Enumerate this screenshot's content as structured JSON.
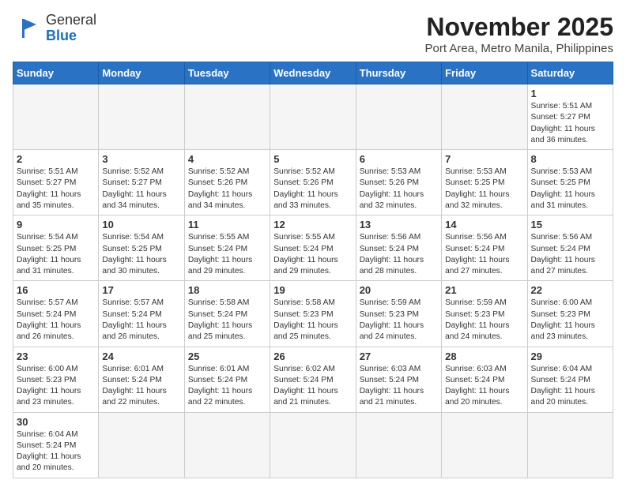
{
  "header": {
    "logo_general": "General",
    "logo_blue": "Blue",
    "month_title": "November 2025",
    "subtitle": "Port Area, Metro Manila, Philippines"
  },
  "weekdays": [
    "Sunday",
    "Monday",
    "Tuesday",
    "Wednesday",
    "Thursday",
    "Friday",
    "Saturday"
  ],
  "days": {
    "1": {
      "sunrise": "5:51 AM",
      "sunset": "5:27 PM",
      "daylight": "11 hours and 36 minutes."
    },
    "2": {
      "sunrise": "5:51 AM",
      "sunset": "5:27 PM",
      "daylight": "11 hours and 35 minutes."
    },
    "3": {
      "sunrise": "5:52 AM",
      "sunset": "5:27 PM",
      "daylight": "11 hours and 34 minutes."
    },
    "4": {
      "sunrise": "5:52 AM",
      "sunset": "5:26 PM",
      "daylight": "11 hours and 34 minutes."
    },
    "5": {
      "sunrise": "5:52 AM",
      "sunset": "5:26 PM",
      "daylight": "11 hours and 33 minutes."
    },
    "6": {
      "sunrise": "5:53 AM",
      "sunset": "5:26 PM",
      "daylight": "11 hours and 32 minutes."
    },
    "7": {
      "sunrise": "5:53 AM",
      "sunset": "5:25 PM",
      "daylight": "11 hours and 32 minutes."
    },
    "8": {
      "sunrise": "5:53 AM",
      "sunset": "5:25 PM",
      "daylight": "11 hours and 31 minutes."
    },
    "9": {
      "sunrise": "5:54 AM",
      "sunset": "5:25 PM",
      "daylight": "11 hours and 31 minutes."
    },
    "10": {
      "sunrise": "5:54 AM",
      "sunset": "5:25 PM",
      "daylight": "11 hours and 30 minutes."
    },
    "11": {
      "sunrise": "5:55 AM",
      "sunset": "5:24 PM",
      "daylight": "11 hours and 29 minutes."
    },
    "12": {
      "sunrise": "5:55 AM",
      "sunset": "5:24 PM",
      "daylight": "11 hours and 29 minutes."
    },
    "13": {
      "sunrise": "5:56 AM",
      "sunset": "5:24 PM",
      "daylight": "11 hours and 28 minutes."
    },
    "14": {
      "sunrise": "5:56 AM",
      "sunset": "5:24 PM",
      "daylight": "11 hours and 27 minutes."
    },
    "15": {
      "sunrise": "5:56 AM",
      "sunset": "5:24 PM",
      "daylight": "11 hours and 27 minutes."
    },
    "16": {
      "sunrise": "5:57 AM",
      "sunset": "5:24 PM",
      "daylight": "11 hours and 26 minutes."
    },
    "17": {
      "sunrise": "5:57 AM",
      "sunset": "5:24 PM",
      "daylight": "11 hours and 26 minutes."
    },
    "18": {
      "sunrise": "5:58 AM",
      "sunset": "5:24 PM",
      "daylight": "11 hours and 25 minutes."
    },
    "19": {
      "sunrise": "5:58 AM",
      "sunset": "5:23 PM",
      "daylight": "11 hours and 25 minutes."
    },
    "20": {
      "sunrise": "5:59 AM",
      "sunset": "5:23 PM",
      "daylight": "11 hours and 24 minutes."
    },
    "21": {
      "sunrise": "5:59 AM",
      "sunset": "5:23 PM",
      "daylight": "11 hours and 24 minutes."
    },
    "22": {
      "sunrise": "6:00 AM",
      "sunset": "5:23 PM",
      "daylight": "11 hours and 23 minutes."
    },
    "23": {
      "sunrise": "6:00 AM",
      "sunset": "5:23 PM",
      "daylight": "11 hours and 23 minutes."
    },
    "24": {
      "sunrise": "6:01 AM",
      "sunset": "5:24 PM",
      "daylight": "11 hours and 22 minutes."
    },
    "25": {
      "sunrise": "6:01 AM",
      "sunset": "5:24 PM",
      "daylight": "11 hours and 22 minutes."
    },
    "26": {
      "sunrise": "6:02 AM",
      "sunset": "5:24 PM",
      "daylight": "11 hours and 21 minutes."
    },
    "27": {
      "sunrise": "6:03 AM",
      "sunset": "5:24 PM",
      "daylight": "11 hours and 21 minutes."
    },
    "28": {
      "sunrise": "6:03 AM",
      "sunset": "5:24 PM",
      "daylight": "11 hours and 20 minutes."
    },
    "29": {
      "sunrise": "6:04 AM",
      "sunset": "5:24 PM",
      "daylight": "11 hours and 20 minutes."
    },
    "30": {
      "sunrise": "6:04 AM",
      "sunset": "5:24 PM",
      "daylight": "11 hours and 20 minutes."
    }
  },
  "labels": {
    "sunrise": "Sunrise:",
    "sunset": "Sunset:",
    "daylight": "Daylight:"
  }
}
